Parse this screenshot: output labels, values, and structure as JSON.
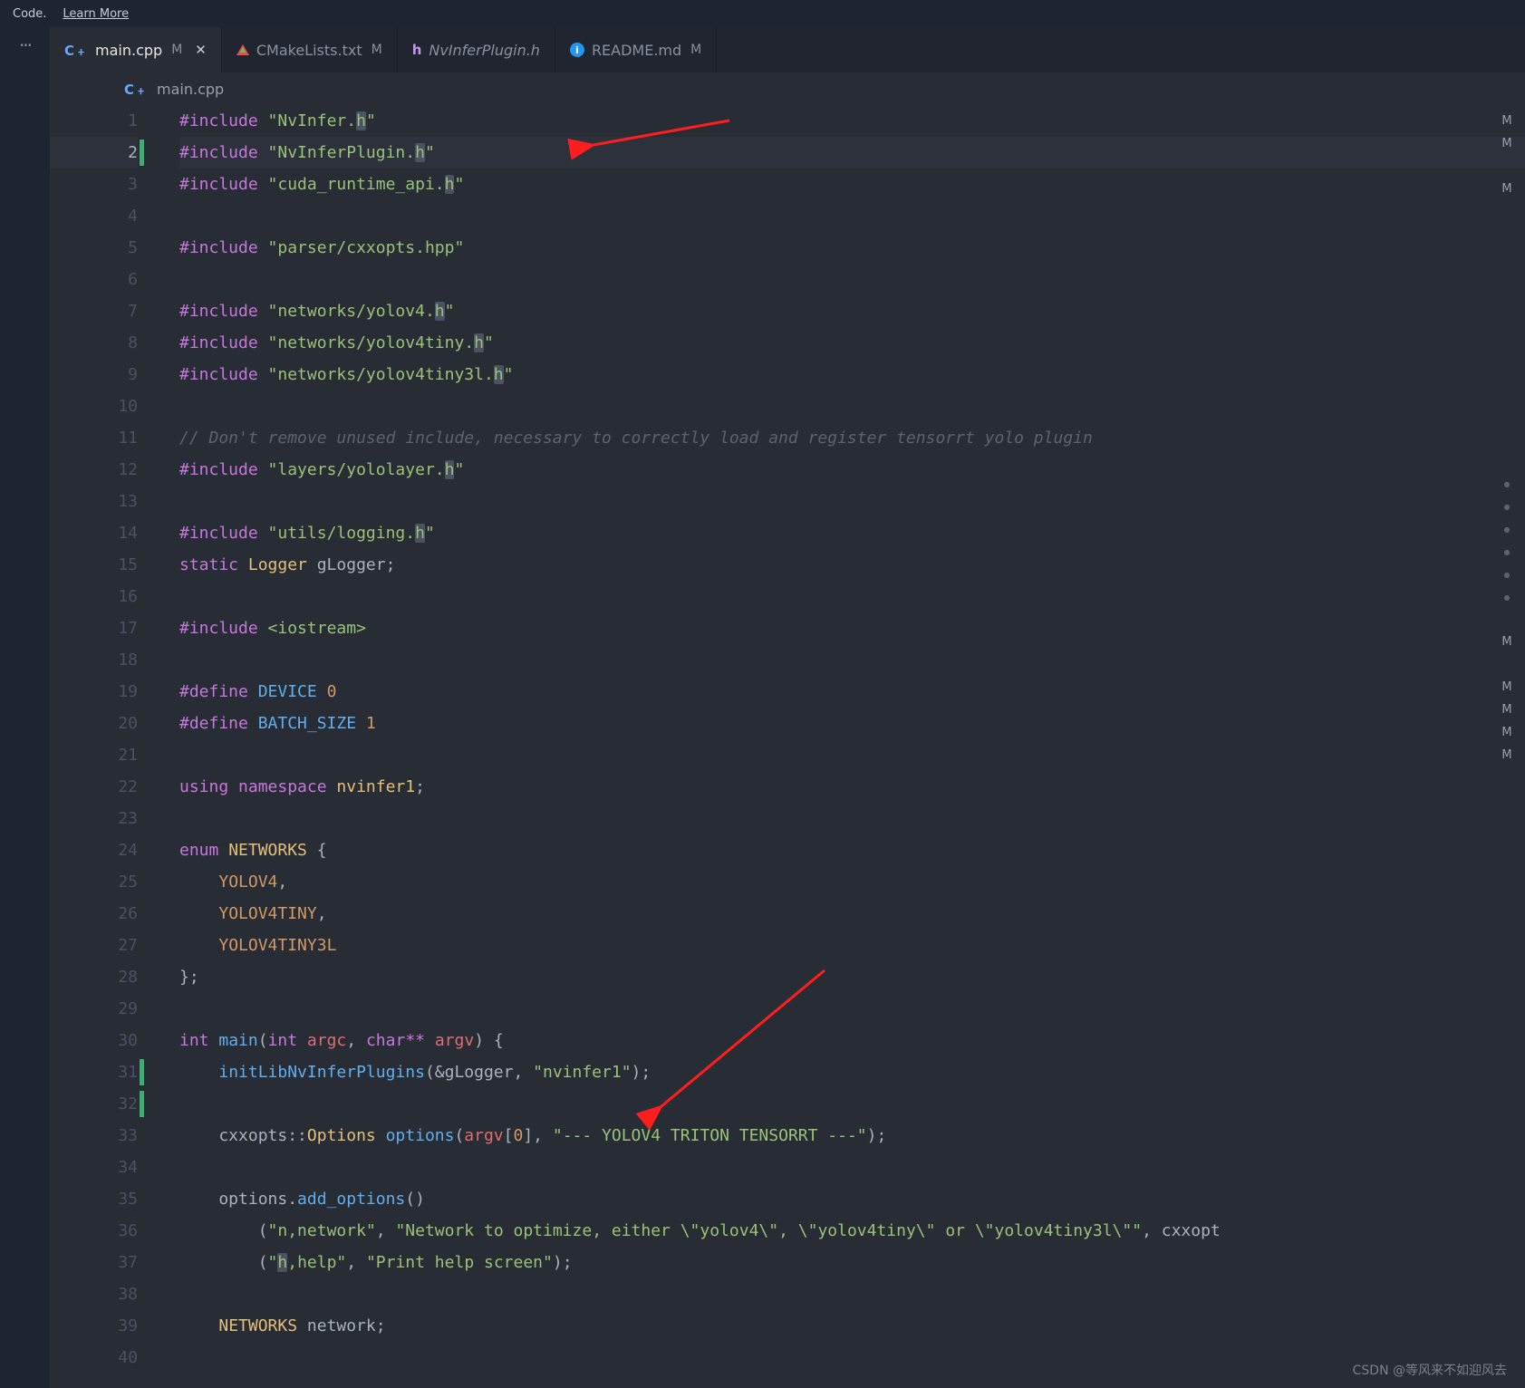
{
  "topbar": {
    "code_label": "Code.",
    "learn_more": "Learn More"
  },
  "activity": {
    "more_label": "···"
  },
  "tabs": [
    {
      "file": "main.cpp",
      "icon": "cpp",
      "modified": "M",
      "active": true,
      "closeable": true
    },
    {
      "file": "CMakeLists.txt",
      "icon": "cmake",
      "modified": "M",
      "active": false
    },
    {
      "file": "NvInferPlugin.h",
      "icon": "h",
      "modified": "",
      "active": false,
      "italic": true
    },
    {
      "file": "README.md",
      "icon": "info",
      "modified": "M",
      "active": false
    }
  ],
  "breadcrumb": {
    "icon": "cpp",
    "file": "main.cpp"
  },
  "gutter": {
    "lines": 40,
    "modified_bars": [
      2,
      31,
      32
    ],
    "current_line": 2
  },
  "code_lines": [
    {
      "n": 1,
      "seg": [
        {
          "c": "kw",
          "t": "#include "
        },
        {
          "c": "str",
          "t": "\"NvInfer."
        },
        {
          "c": "str hlchar",
          "t": "h"
        },
        {
          "c": "str",
          "t": "\""
        }
      ]
    },
    {
      "n": 2,
      "hl": true,
      "seg": [
        {
          "c": "kw",
          "t": "#include "
        },
        {
          "c": "str",
          "t": "\"NvInferPlugin."
        },
        {
          "c": "str hlchar",
          "t": "h"
        },
        {
          "c": "str",
          "t": "\""
        }
      ]
    },
    {
      "n": 3,
      "seg": [
        {
          "c": "kw",
          "t": "#include "
        },
        {
          "c": "str",
          "t": "\"cuda_runtime_api."
        },
        {
          "c": "str hlchar",
          "t": "h"
        },
        {
          "c": "str",
          "t": "\""
        }
      ]
    },
    {
      "n": 4,
      "seg": []
    },
    {
      "n": 5,
      "seg": [
        {
          "c": "kw",
          "t": "#include "
        },
        {
          "c": "str",
          "t": "\"parser/cxxopts.hpp\""
        }
      ]
    },
    {
      "n": 6,
      "seg": []
    },
    {
      "n": 7,
      "seg": [
        {
          "c": "kw",
          "t": "#include "
        },
        {
          "c": "str",
          "t": "\"networks/yolov4."
        },
        {
          "c": "str hlchar",
          "t": "h"
        },
        {
          "c": "str",
          "t": "\""
        }
      ]
    },
    {
      "n": 8,
      "seg": [
        {
          "c": "kw",
          "t": "#include "
        },
        {
          "c": "str",
          "t": "\"networks/yolov4tiny."
        },
        {
          "c": "str hlchar",
          "t": "h"
        },
        {
          "c": "str",
          "t": "\""
        }
      ]
    },
    {
      "n": 9,
      "seg": [
        {
          "c": "kw",
          "t": "#include "
        },
        {
          "c": "str",
          "t": "\"networks/yolov4tiny3l."
        },
        {
          "c": "str hlchar",
          "t": "h"
        },
        {
          "c": "str",
          "t": "\""
        }
      ]
    },
    {
      "n": 10,
      "seg": []
    },
    {
      "n": 11,
      "seg": [
        {
          "c": "cmt",
          "t": "// Don't remove unused include, necessary to correctly load and register tensorrt yolo plugin"
        }
      ]
    },
    {
      "n": 12,
      "seg": [
        {
          "c": "kw",
          "t": "#include "
        },
        {
          "c": "str",
          "t": "\"layers/yololayer."
        },
        {
          "c": "str hlchar",
          "t": "h"
        },
        {
          "c": "str",
          "t": "\""
        }
      ]
    },
    {
      "n": 13,
      "seg": []
    },
    {
      "n": 14,
      "seg": [
        {
          "c": "kw",
          "t": "#include "
        },
        {
          "c": "str",
          "t": "\"utils/logging."
        },
        {
          "c": "str hlchar",
          "t": "h"
        },
        {
          "c": "str",
          "t": "\""
        }
      ]
    },
    {
      "n": 15,
      "seg": [
        {
          "c": "kw",
          "t": "static "
        },
        {
          "c": "typ",
          "t": "Logger "
        },
        {
          "c": "white",
          "t": "gLogger;"
        }
      ]
    },
    {
      "n": 16,
      "seg": []
    },
    {
      "n": 17,
      "seg": [
        {
          "c": "kw",
          "t": "#include "
        },
        {
          "c": "str",
          "t": "<iostream>"
        }
      ]
    },
    {
      "n": 18,
      "seg": []
    },
    {
      "n": 19,
      "seg": [
        {
          "c": "kw",
          "t": "#define "
        },
        {
          "c": "fn",
          "t": "DEVICE "
        },
        {
          "c": "num",
          "t": "0"
        }
      ]
    },
    {
      "n": 20,
      "seg": [
        {
          "c": "kw",
          "t": "#define "
        },
        {
          "c": "fn",
          "t": "BATCH_SIZE "
        },
        {
          "c": "num",
          "t": "1"
        }
      ]
    },
    {
      "n": 21,
      "seg": []
    },
    {
      "n": 22,
      "seg": [
        {
          "c": "kw",
          "t": "using namespace "
        },
        {
          "c": "typ",
          "t": "nvinfer1"
        },
        {
          "c": "white",
          "t": ";"
        }
      ]
    },
    {
      "n": 23,
      "seg": []
    },
    {
      "n": 24,
      "seg": [
        {
          "c": "kw",
          "t": "enum "
        },
        {
          "c": "typ",
          "t": "NETWORKS "
        },
        {
          "c": "white",
          "t": "{"
        }
      ]
    },
    {
      "n": 25,
      "seg": [
        {
          "c": "white",
          "t": "    "
        },
        {
          "c": "enumv",
          "t": "YOLOV4"
        },
        {
          "c": "white",
          "t": ","
        }
      ]
    },
    {
      "n": 26,
      "seg": [
        {
          "c": "white",
          "t": "    "
        },
        {
          "c": "enumv",
          "t": "YOLOV4TINY"
        },
        {
          "c": "white",
          "t": ","
        }
      ]
    },
    {
      "n": 27,
      "seg": [
        {
          "c": "white",
          "t": "    "
        },
        {
          "c": "enumv",
          "t": "YOLOV4TINY3L"
        }
      ]
    },
    {
      "n": 28,
      "seg": [
        {
          "c": "white",
          "t": "};"
        }
      ]
    },
    {
      "n": 29,
      "seg": []
    },
    {
      "n": 30,
      "seg": [
        {
          "c": "kw",
          "t": "int "
        },
        {
          "c": "fn",
          "t": "main"
        },
        {
          "c": "white",
          "t": "("
        },
        {
          "c": "kw",
          "t": "int "
        },
        {
          "c": "var",
          "t": "argc"
        },
        {
          "c": "white",
          "t": ", "
        },
        {
          "c": "kw",
          "t": "char** "
        },
        {
          "c": "var",
          "t": "argv"
        },
        {
          "c": "white",
          "t": ") {"
        }
      ]
    },
    {
      "n": 31,
      "seg": [
        {
          "c": "white",
          "t": "    "
        },
        {
          "c": "fn",
          "t": "initLibNvInferPlugins"
        },
        {
          "c": "white",
          "t": "(&gLogger, "
        },
        {
          "c": "str",
          "t": "\"nvinfer1\""
        },
        {
          "c": "white",
          "t": ");"
        }
      ]
    },
    {
      "n": 32,
      "seg": []
    },
    {
      "n": 33,
      "seg": [
        {
          "c": "white",
          "t": "    cxxopts::"
        },
        {
          "c": "typ",
          "t": "Options "
        },
        {
          "c": "fn",
          "t": "options"
        },
        {
          "c": "white",
          "t": "("
        },
        {
          "c": "var",
          "t": "argv"
        },
        {
          "c": "white",
          "t": "["
        },
        {
          "c": "num",
          "t": "0"
        },
        {
          "c": "white",
          "t": "], "
        },
        {
          "c": "str",
          "t": "\"--- YOLOV4 TRITON TENSORRT ---\""
        },
        {
          "c": "white",
          "t": ");"
        }
      ]
    },
    {
      "n": 34,
      "seg": []
    },
    {
      "n": 35,
      "seg": [
        {
          "c": "white",
          "t": "    options."
        },
        {
          "c": "fn",
          "t": "add_options"
        },
        {
          "c": "white",
          "t": "()"
        }
      ]
    },
    {
      "n": 36,
      "seg": [
        {
          "c": "white",
          "t": "        ("
        },
        {
          "c": "str",
          "t": "\"n,network\""
        },
        {
          "c": "white",
          "t": ", "
        },
        {
          "c": "str",
          "t": "\"Network to optimize, either \\\"yolov4\\\", \\\"yolov4tiny\\\" or \\\"yolov4tiny3l\\\"\""
        },
        {
          "c": "white",
          "t": ", cxxopt"
        }
      ]
    },
    {
      "n": 37,
      "seg": [
        {
          "c": "white",
          "t": "        ("
        },
        {
          "c": "str",
          "t": "\""
        },
        {
          "c": "str hlchar",
          "t": "h"
        },
        {
          "c": "str",
          "t": ",help\""
        },
        {
          "c": "white",
          "t": ", "
        },
        {
          "c": "str",
          "t": "\"Print help screen\""
        },
        {
          "c": "white",
          "t": ");"
        }
      ]
    },
    {
      "n": 38,
      "seg": []
    },
    {
      "n": 39,
      "seg": [
        {
          "c": "white",
          "t": "    "
        },
        {
          "c": "typ",
          "t": "NETWORKS "
        },
        {
          "c": "white",
          "t": "network;"
        }
      ]
    },
    {
      "n": 40,
      "seg": []
    }
  ],
  "minimap": [
    "M",
    "M",
    "",
    "M",
    "",
    "",
    "",
    "",
    "",
    "",
    "",
    "",
    "",
    "",
    "",
    "",
    "dot",
    "dot",
    "dot",
    "dot",
    "dot",
    "dot",
    "",
    "M",
    "",
    "M",
    "M",
    "M",
    "M"
  ],
  "watermark": "CSDN @等风来不如迎风去"
}
